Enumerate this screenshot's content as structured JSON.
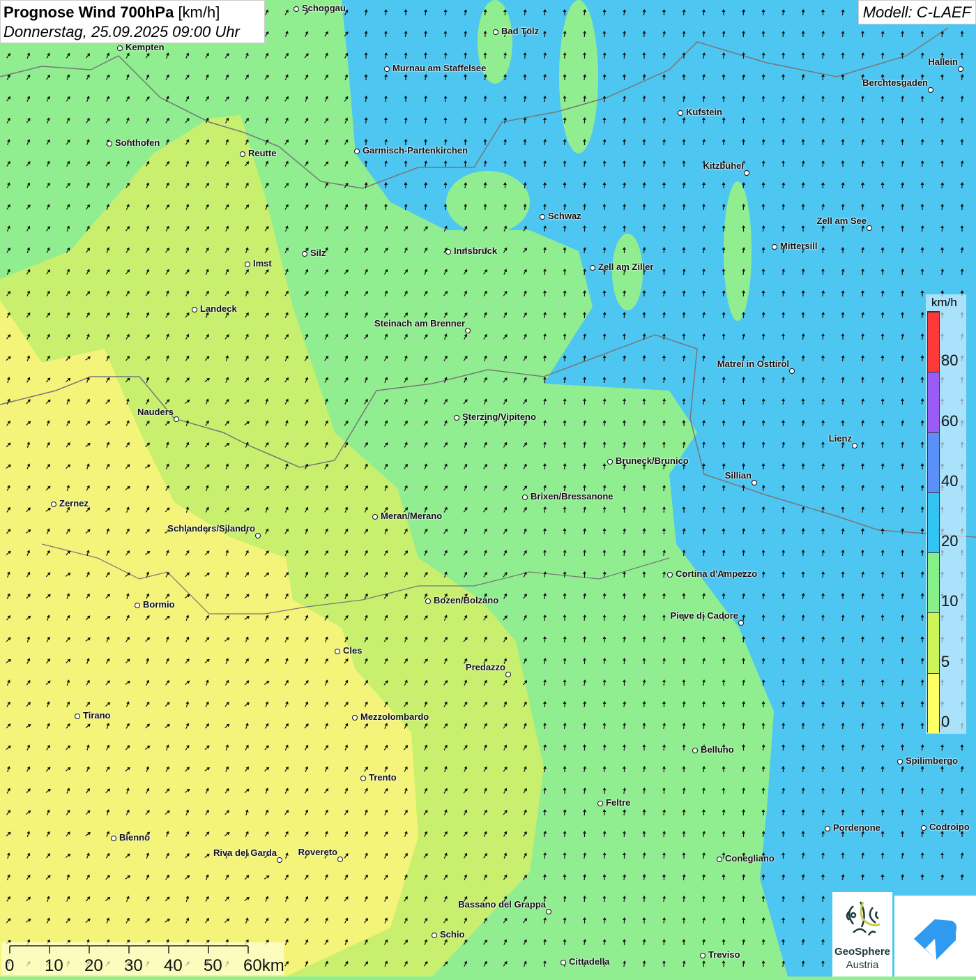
{
  "header": {
    "title": "Prognose Wind 700hPa",
    "unit": "[km/h]",
    "datetime": "Donnerstag, 25.09.2025 09:00 Uhr",
    "model": "Modell: C-LAEF"
  },
  "legend": {
    "unit": "km/h",
    "classes": [
      {
        "label": "0",
        "color": "#ffff66"
      },
      {
        "label": "5",
        "color": "#ccf55a"
      },
      {
        "label": "10",
        "color": "#88f088"
      },
      {
        "label": "20",
        "color": "#33c4f4"
      },
      {
        "label": "40",
        "color": "#5a90f8"
      },
      {
        "label": "60",
        "color": "#9a5cf4"
      },
      {
        "label": "80",
        "color": "#ff3838"
      }
    ]
  },
  "scale_bar": {
    "labels": [
      "0",
      "10",
      "20",
      "30",
      "40",
      "50",
      "60km"
    ]
  },
  "logos": {
    "geosphere_line1": "GeoSphere",
    "geosphere_line2": "Austria"
  },
  "colors": {
    "yellow": "#f4f47a",
    "yellow_green": "#c8f06e",
    "green": "#90ee90",
    "blue": "#4ec6f2",
    "border": "#777777"
  },
  "cities": [
    "Schongau",
    "Kempten",
    "Bad Tölz",
    "Murnau am Staffelsee",
    "Hallein",
    "Berchtesgaden",
    "Kufstein",
    "Sonthofen",
    "Reutte",
    "Garmisch-Partenkirchen",
    "Kitzbühel",
    "Schwaz",
    "Zell am See",
    "Mittersill",
    "Silz",
    "Innsbruck",
    "Imst",
    "Zell am Ziller",
    "Landeck",
    "Steinach am Brenner",
    "Matrei in Osttirol",
    "Nauders",
    "Sterzing/Vipiteno",
    "Lienz",
    "Bruneck/Brunico",
    "Sillian",
    "Brixen/Bressanone",
    "Zernez",
    "Meran/Merano",
    "Schlanders/Silandro",
    "Cortina d'Ampezzo",
    "Bozen/Bolzano",
    "Bormio",
    "Pieve di Cadore",
    "Cles",
    "Predazzo",
    "Tirano",
    "Mezzolombardo",
    "Belluno",
    "Spilimbergo",
    "Trento",
    "Feltre",
    "Bienno",
    "Pordenone",
    "Codroipo",
    "Riva del Garda",
    "Rovereto",
    "Conegliano",
    "Bassano del Grappa",
    "Schio",
    "Treviso",
    "Cittadella"
  ]
}
